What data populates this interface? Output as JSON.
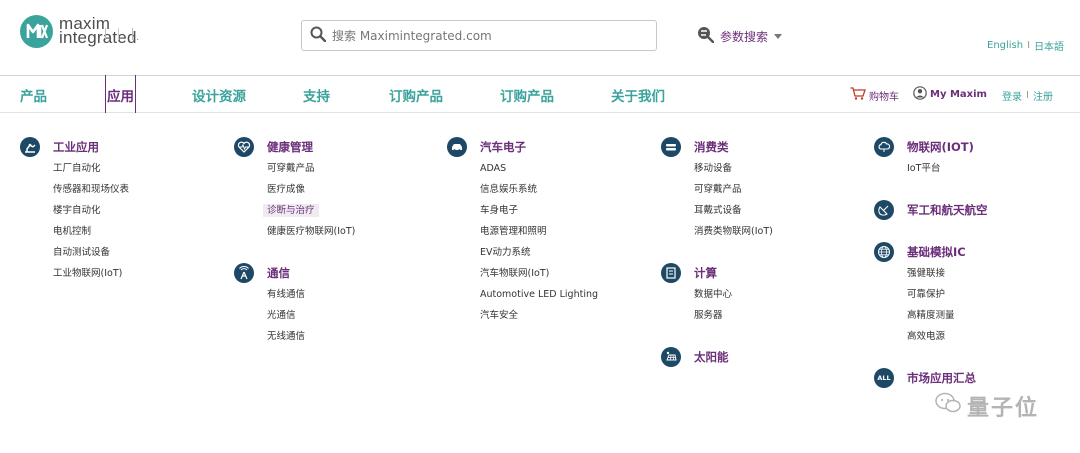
{
  "logo": {
    "line1": "maxim",
    "line2": "integrated",
    "tm": "."
  },
  "search": {
    "placeholder": "搜索 Maximintegrated.com"
  },
  "param_search": {
    "label": "参数搜索"
  },
  "language": {
    "en": "English",
    "ja": "日本語",
    "sep": "I"
  },
  "nav": {
    "items": [
      {
        "label": "产品"
      },
      {
        "label": "应用"
      },
      {
        "label": "设计资源"
      },
      {
        "label": "支持"
      },
      {
        "label": "订购产品"
      },
      {
        "label": "订购产品"
      },
      {
        "label": "关于我们"
      }
    ],
    "cart": "购物车",
    "my_maxim": "My Maxim",
    "login": "登录",
    "register": "注册",
    "sep": "I"
  },
  "categories": {
    "industrial": {
      "title": "工业应用",
      "icon": "industrial-robot-arm-icon",
      "items": [
        "工厂自动化",
        "传感器和现场仪表",
        "楼宇自动化",
        "电机控制",
        "自动测试设备",
        "工业物联网(IoT)"
      ]
    },
    "healthcare": {
      "title": "健康管理",
      "icon": "heartbeat-icon",
      "items": [
        "可穿戴产品",
        "医疗成像",
        "诊断与治疗",
        "健康医疗物联网(IoT)"
      ]
    },
    "communications": {
      "title": "通信",
      "icon": "antenna-tower-icon",
      "items": [
        "有线通信",
        "光通信",
        "无线通信"
      ]
    },
    "automotive": {
      "title": "汽车电子",
      "icon": "car-icon",
      "items": [
        "ADAS",
        "信息娱乐系统",
        "车身电子",
        "电源管理和照明",
        "EV动力系统",
        "汽车物联网(IoT)",
        "Automotive LED Lighting",
        "汽车安全"
      ]
    },
    "consumer": {
      "title": "消费类",
      "icon": "game-controller-icon",
      "items": [
        "移动设备",
        "可穿戴产品",
        "耳戴式设备",
        "消费类物联网(IoT)"
      ]
    },
    "computing": {
      "title": "计算",
      "icon": "server-icon",
      "items": [
        "数据中心",
        "服务器"
      ]
    },
    "solar": {
      "title": "太阳能",
      "icon": "solar-panel-icon"
    },
    "iot": {
      "title": "物联网(IOT)",
      "icon": "cloud-icon",
      "items": [
        "IoT平台"
      ]
    },
    "aerospace": {
      "title": "军工和航天航空",
      "icon": "satellite-icon"
    },
    "analog": {
      "title": "基础模拟IC",
      "icon": "globe-grid-icon",
      "items": [
        "强健联接",
        "可靠保护",
        "高精度测量",
        "高效电源"
      ]
    },
    "all": {
      "title": "市场应用汇总",
      "icon_text": "ALL"
    }
  },
  "colors": {
    "teal": "#3aa39b",
    "purple": "#6b2f7a",
    "navy": "#1e4966"
  },
  "watermark": {
    "text": "量子位"
  }
}
